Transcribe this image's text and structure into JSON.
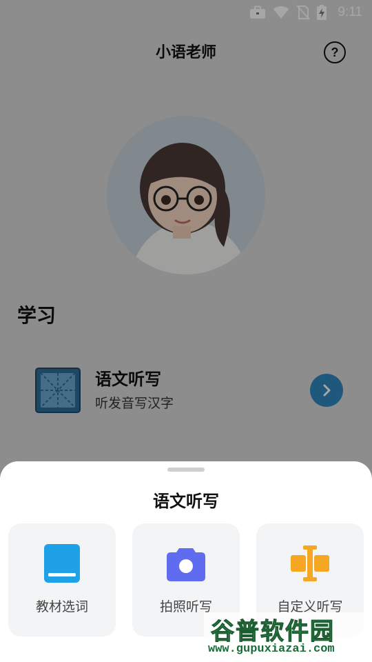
{
  "status_bar": {
    "time": "9:11"
  },
  "header": {
    "title": "小语老师",
    "help_label": "?"
  },
  "section": {
    "title": "学习"
  },
  "study_card": {
    "title": "语文听写",
    "subtitle": "听发音写汉字"
  },
  "sheet": {
    "title": "语文听写",
    "options": [
      {
        "label": "教材选词",
        "icon": "book-icon",
        "color": "#1ea1e6"
      },
      {
        "label": "拍照听写",
        "icon": "camera-icon",
        "color": "#5f6cf0"
      },
      {
        "label": "自定义听写",
        "icon": "text-cursor-icon",
        "color": "#f5a623"
      }
    ]
  },
  "watermark": {
    "logo": "谷普软件园",
    "url": "www.gupuxiazai.com"
  },
  "colors": {
    "accent": "#2f89c0",
    "sheet_bg": "#ffffff",
    "card_bg": "#f3f4f6"
  }
}
